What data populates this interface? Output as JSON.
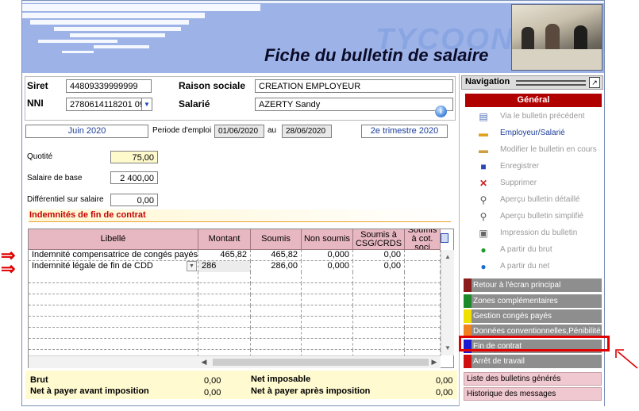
{
  "header": {
    "brand": "TYCOON",
    "title": "Fiche du bulletin de salaire"
  },
  "identity": {
    "siret_label": "Siret",
    "siret_value": "44809339999999",
    "nni_label": "NNI",
    "nni_value": "2780614118201 09",
    "raison_label": "Raison sociale",
    "raison_value": "CREATION EMPLOYEUR",
    "salarie_label": "Salarié",
    "salarie_value": "AZERTY Sandy"
  },
  "period": {
    "month": "Juin 2020",
    "periode_label": "Periode d'emploi",
    "start": "01/06/2020",
    "au_label": "au",
    "end": "28/06/2020",
    "quarter": "2e trimestre 2020"
  },
  "fields": {
    "quotite_label": "Quotité",
    "quotite_value": "75,00",
    "salaire_label": "Salaire de base",
    "salaire_value": "2 400,00",
    "differentiel_label": "Différentiel sur salaire",
    "differentiel_value": "0,00"
  },
  "section": {
    "title": "Indemnités de fin de contrat"
  },
  "grid": {
    "headers": [
      "Libellé",
      "Montant",
      "Soumis",
      "Non soumis",
      "Soumis à CSG/CRDS",
      "Soumis à cot. soci"
    ],
    "rows": [
      {
        "libelle": "Indemnité compensatrice de congés payés",
        "montant": "465,82",
        "soumis": "465,82",
        "non_soumis": "0,000",
        "csg": "0,00",
        "soci": ""
      },
      {
        "libelle": "Indemnité légale de fin de CDD",
        "montant": "286",
        "soumis": "286,00",
        "non_soumis": "0,000",
        "csg": "0,00",
        "soci": ""
      }
    ]
  },
  "totals": {
    "brut_label": "Brut",
    "brut_value": "0,00",
    "net_imposable_label": "Net imposable",
    "net_imposable_value": "0,00",
    "net_avant_label": "Net à payer avant imposition",
    "net_avant_value": "0,00",
    "net_apres_label": "Net à payer après imposition",
    "net_apres_value": "0,00"
  },
  "nav": {
    "title": "Navigation",
    "group": "Général",
    "actions": [
      {
        "label": "Via le bulletin précédent",
        "icon": "document-icon",
        "enabled": false
      },
      {
        "label": "Employeur/Salarié",
        "icon": "folder-icon",
        "enabled": true
      },
      {
        "label": "Modifier le bulletin en cours",
        "icon": "folder-icon",
        "enabled": false
      },
      {
        "label": "Enregistrer",
        "icon": "save-icon",
        "enabled": false
      },
      {
        "label": "Supprimer",
        "icon": "delete-icon",
        "enabled": false
      },
      {
        "label": "Aperçu bulletin détaillé",
        "icon": "zoom-icon",
        "enabled": false
      },
      {
        "label": "Aperçu bulletin simplifié",
        "icon": "zoom-icon",
        "enabled": false
      },
      {
        "label": "Impression du bulletin",
        "icon": "printer-icon",
        "enabled": false
      },
      {
        "label": "A partir du brut",
        "icon": "green-circle-icon",
        "enabled": false
      },
      {
        "label": "A partir du net",
        "icon": "blue-circle-icon",
        "enabled": false
      }
    ],
    "categories": [
      {
        "label": "Retour à l'écran principal",
        "color": "#8b1a1a"
      },
      {
        "label": "Zones complémentaires",
        "color": "#1a8a2a"
      },
      {
        "label": "Gestion congés payés",
        "color": "#f0e000"
      },
      {
        "label": "Données conventionnelles,Pénibilité",
        "color": "#f08020"
      },
      {
        "label": "Fin de contrat",
        "color": "#1a1ad0"
      },
      {
        "label": "Arrêt de travail",
        "color": "#d01010"
      }
    ],
    "links": [
      {
        "label": "Liste des bulletins générés"
      },
      {
        "label": "Historique des messages"
      }
    ]
  }
}
